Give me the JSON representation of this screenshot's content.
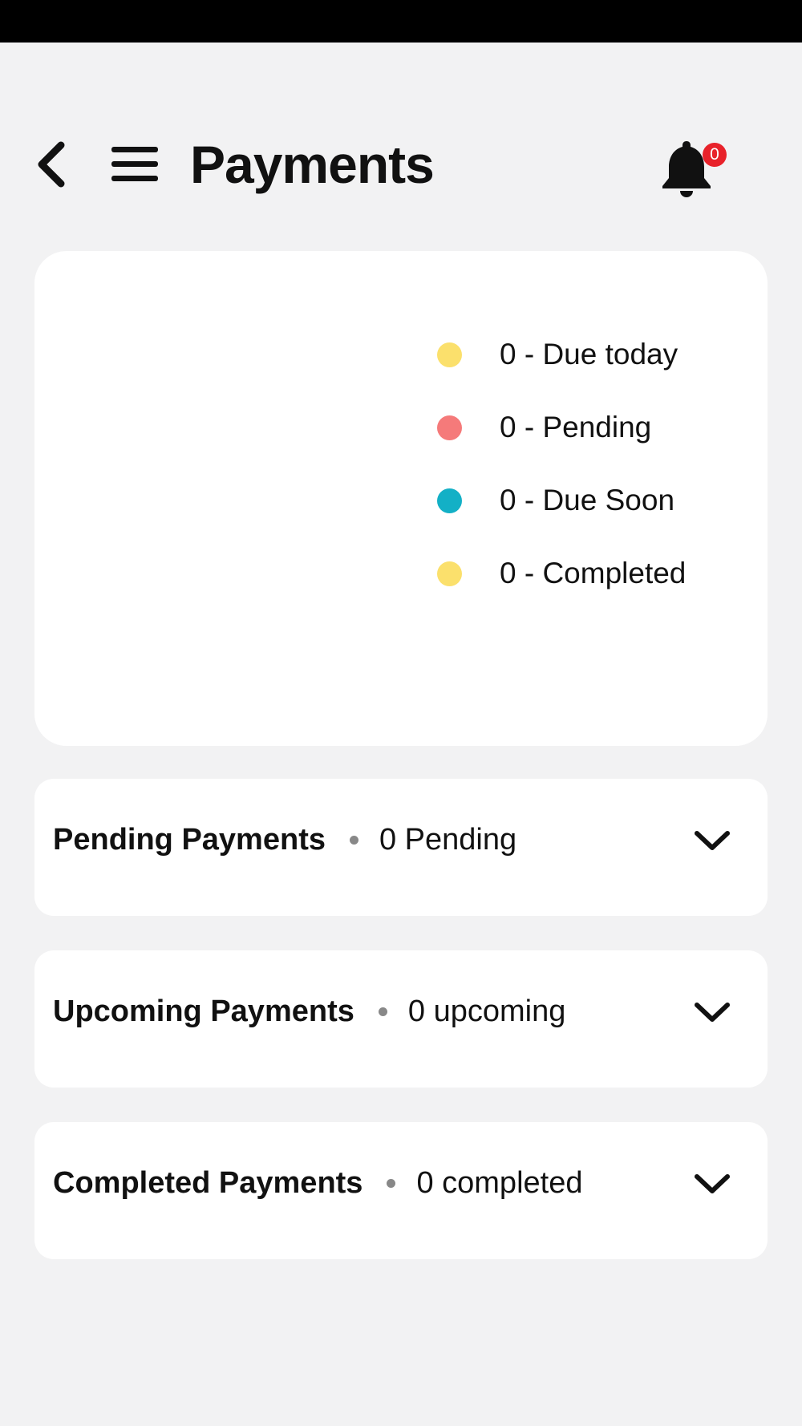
{
  "header": {
    "title": "Payments",
    "notification_count": "0"
  },
  "summary": {
    "legend": [
      {
        "label": "0 - Due today",
        "color": "#fbe06c"
      },
      {
        "label": "0 - Pending",
        "color": "#f57a7a"
      },
      {
        "label": "0 - Due Soon",
        "color": "#13b0c6"
      },
      {
        "label": "0 - Completed",
        "color": "#fbe06c"
      }
    ]
  },
  "sections": [
    {
      "title": "Pending Payments",
      "count": "0 Pending"
    },
    {
      "title": "Upcoming Payments",
      "count": "0 upcoming"
    },
    {
      "title": "Completed Payments",
      "count": "0 completed"
    }
  ],
  "icons": {
    "back": "chevron-left-icon",
    "menu": "hamburger-menu-icon",
    "notifications": "bell-icon",
    "expand": "chevron-down-icon"
  }
}
